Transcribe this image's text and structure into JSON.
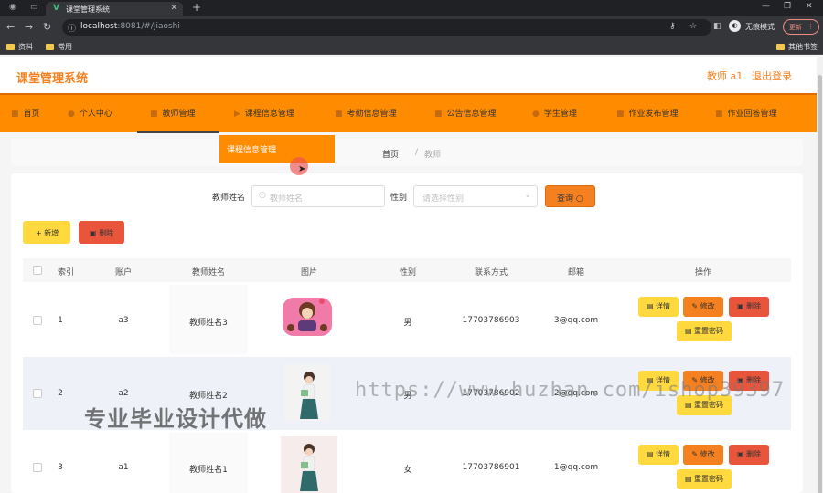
{
  "browser": {
    "tab_title": "课堂管理系统",
    "url_host": "localhost",
    "url_rest": ":8081/#/jiaoshi",
    "profile_label": "无痕模式",
    "update_label": "更新",
    "bookmarks": [
      "资料",
      "常用"
    ],
    "other_bookmarks": "其他书签"
  },
  "app": {
    "title": "课堂管理系统",
    "user": "教师 a1",
    "logout": "退出登录"
  },
  "menu": {
    "items": [
      {
        "label": "首页",
        "icon": "home-icon"
      },
      {
        "label": "个人中心",
        "icon": "user-icon"
      },
      {
        "label": "教师管理",
        "icon": "teacher-icon"
      },
      {
        "label": "课程信息管理",
        "icon": "course-icon"
      },
      {
        "label": "考勤信息管理",
        "icon": "attendance-icon"
      },
      {
        "label": "公告信息管理",
        "icon": "notice-icon"
      },
      {
        "label": "学生管理",
        "icon": "student-icon"
      },
      {
        "label": "作业发布管理",
        "icon": "assignment-icon"
      },
      {
        "label": "作业回答管理",
        "icon": "answer-icon"
      }
    ],
    "dropdown_item": "课程信息管理"
  },
  "breadcrumb": {
    "home": "首页",
    "separator": "/",
    "current": "教师"
  },
  "search": {
    "name_label": "教师姓名",
    "name_placeholder": "教师姓名",
    "gender_label": "性别",
    "gender_placeholder": "请选择性别",
    "query_label": "查询"
  },
  "toolbar": {
    "add_label": "+ 新增",
    "delete_label": "删除"
  },
  "table": {
    "headers": [
      "索引",
      "账户",
      "教师姓名",
      "图片",
      "性别",
      "联系方式",
      "邮箱",
      "操作"
    ],
    "rows": [
      {
        "index": "1",
        "account": "a3",
        "name": "教师姓名3",
        "gender": "男",
        "phone": "17703786903",
        "email": "3@qq.com"
      },
      {
        "index": "2",
        "account": "a2",
        "name": "教师姓名2",
        "gender": "男",
        "phone": "17703786902",
        "email": "2@qq.com"
      },
      {
        "index": "3",
        "account": "a1",
        "name": "教师姓名1",
        "gender": "女",
        "phone": "17703786901",
        "email": "1@qq.com"
      }
    ],
    "actions": {
      "detail": "详情",
      "edit": "修改",
      "remove": "删除",
      "reset": "重置密码"
    }
  },
  "watermarks": {
    "left": "专业毕业设计代做",
    "right": "https://www.huzhan.com/ishop39397"
  },
  "colors": {
    "accent": "#ff8c00",
    "title": "#f4801f",
    "yellow_button": "#ffd93d",
    "red_button": "#e8553a"
  }
}
